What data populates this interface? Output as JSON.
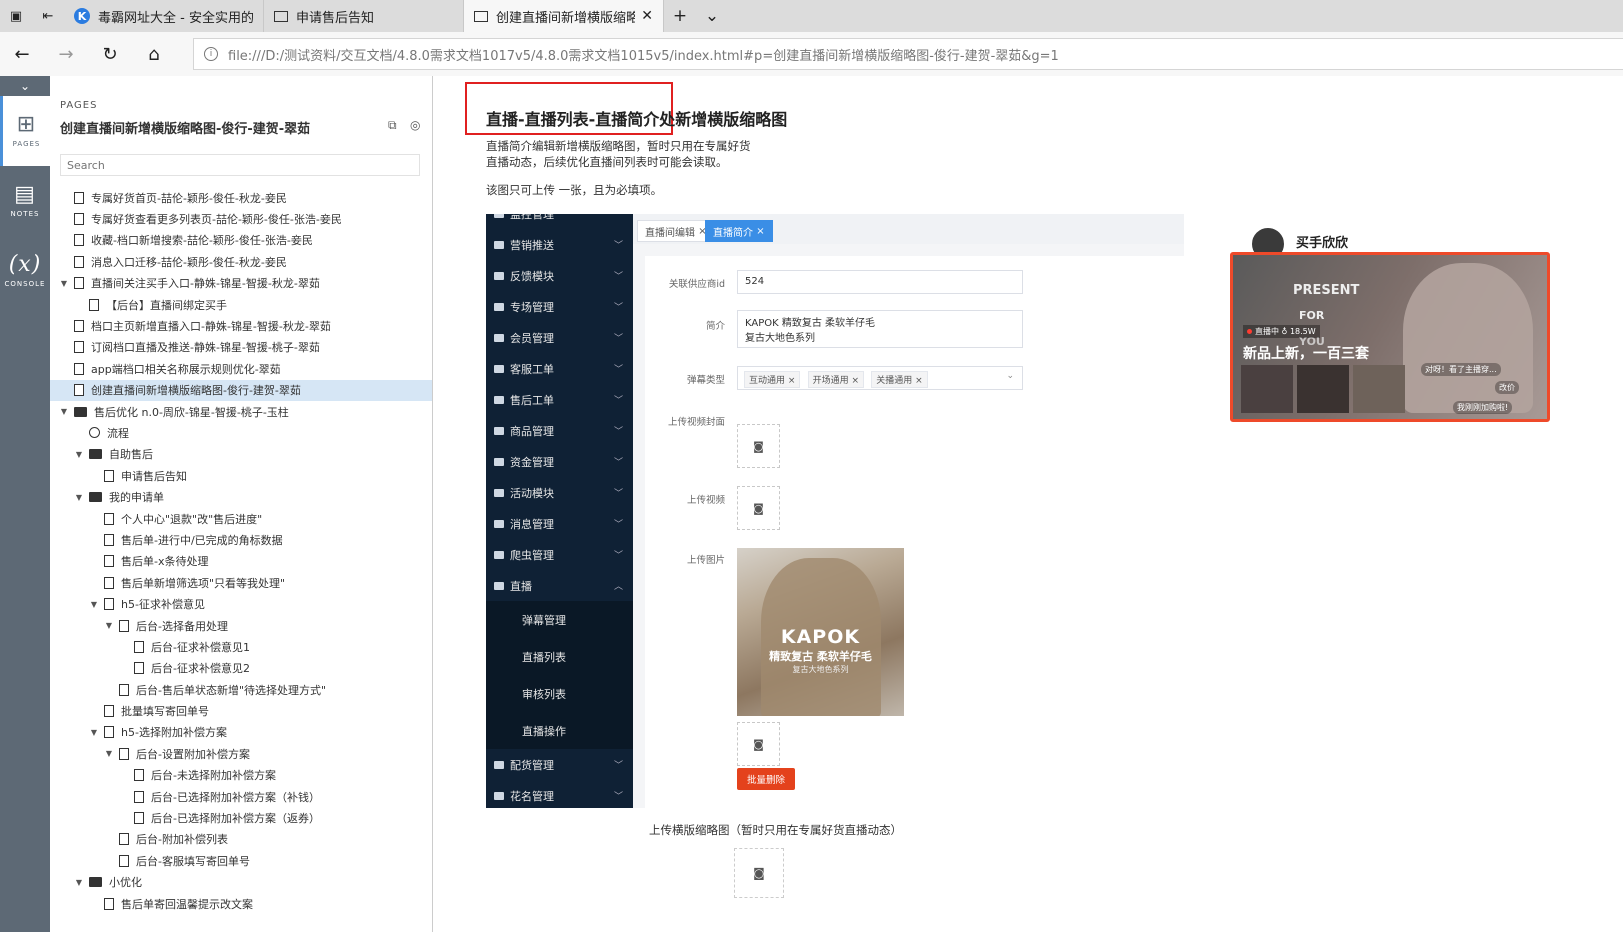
{
  "browser": {
    "tabs": [
      {
        "label": "毒霸网址大全 - 安全实用的"
      },
      {
        "label": "申请售后告知"
      },
      {
        "label": "创建直播间新增横版缩略"
      }
    ],
    "url": "file:///D:/测试资料/交互文档/4.8.0需求文档1017v5/4.8.0需求文档1015v5/index.html#p=创建直播间新增横版缩略图-俊行-建贺-翠茹&g=1"
  },
  "rail": {
    "pages": "PAGES",
    "notes": "NOTES",
    "console": "CONSOLE"
  },
  "sidebar": {
    "section_label": "PAGES",
    "title": "创建直播间新增横版缩略图-俊行-建贺-翠茹",
    "search_placeholder": "Search",
    "tree": [
      {
        "label": "专属好货首页-喆伦-颖彤-俊任-秋龙-妾民",
        "depth": 0,
        "type": "page"
      },
      {
        "label": "专属好货查看更多列表页-喆伦-颖彤-俊任-张浩-妾民",
        "depth": 0,
        "type": "page"
      },
      {
        "label": "收藏-档口新增搜索-喆伦-颖彤-俊任-张浩-妾民",
        "depth": 0,
        "type": "page"
      },
      {
        "label": "消息入口迁移-喆伦-颖彤-俊任-秋龙-妾民",
        "depth": 0,
        "type": "page"
      },
      {
        "label": "直播间关注买手入口-静姝-锦星-智援-秋龙-翠茹",
        "depth": 0,
        "type": "page",
        "expanded": true
      },
      {
        "label": "【后台】直播间绑定买手",
        "depth": 1,
        "type": "page"
      },
      {
        "label": "档口主页新增直播入口-静姝-锦星-智援-秋龙-翠茹",
        "depth": 0,
        "type": "page"
      },
      {
        "label": "订阅档口直播及推送-静姝-锦星-智援-桃子-翠茹",
        "depth": 0,
        "type": "page"
      },
      {
        "label": "app端档口相关名称展示规则优化-翠茹",
        "depth": 0,
        "type": "page"
      },
      {
        "label": "创建直播间新增横版缩略图-俊行-建贺-翠茹",
        "depth": 0,
        "type": "page",
        "selected": true
      },
      {
        "label": "售后优化 n.0-周欣-锦星-智援-桃子-玉柱",
        "depth": 0,
        "type": "folder",
        "expanded": true
      },
      {
        "label": "流程",
        "depth": 1,
        "type": "flow"
      },
      {
        "label": "自助售后",
        "depth": 1,
        "type": "folder",
        "expanded": true
      },
      {
        "label": "申请售后告知",
        "depth": 2,
        "type": "page"
      },
      {
        "label": "我的申请单",
        "depth": 1,
        "type": "folder",
        "expanded": true
      },
      {
        "label": "个人中心\"退款\"改\"售后进度\"",
        "depth": 2,
        "type": "page"
      },
      {
        "label": "售后单-进行中/已完成的角标数据",
        "depth": 2,
        "type": "page"
      },
      {
        "label": "售后单-x条待处理",
        "depth": 2,
        "type": "page"
      },
      {
        "label": "售后单新增筛选项\"只看等我处理\"",
        "depth": 2,
        "type": "page"
      },
      {
        "label": "h5-征求补偿意见",
        "depth": 2,
        "type": "page",
        "expanded": true
      },
      {
        "label": "后台-选择备用处理",
        "depth": 3,
        "type": "page",
        "expanded": true
      },
      {
        "label": "后台-征求补偿意见1",
        "depth": 4,
        "type": "page"
      },
      {
        "label": "后台-征求补偿意见2",
        "depth": 4,
        "type": "page"
      },
      {
        "label": "后台-售后单状态新增\"待选择处理方式\"",
        "depth": 3,
        "type": "page"
      },
      {
        "label": "批量填写寄回单号",
        "depth": 2,
        "type": "page"
      },
      {
        "label": "h5-选择附加补偿方案",
        "depth": 2,
        "type": "page",
        "expanded": true
      },
      {
        "label": "后台-设置附加补偿方案",
        "depth": 3,
        "type": "page",
        "expanded": true
      },
      {
        "label": "后台-未选择附加补偿方案",
        "depth": 4,
        "type": "page"
      },
      {
        "label": "后台-已选择附加补偿方案（补钱）",
        "depth": 4,
        "type": "page"
      },
      {
        "label": "后台-已选择附加补偿方案（返券）",
        "depth": 4,
        "type": "page"
      },
      {
        "label": "后台-附加补偿列表",
        "depth": 3,
        "type": "page"
      },
      {
        "label": "后台-客服填写寄回单号",
        "depth": 3,
        "type": "page"
      },
      {
        "label": "小优化",
        "depth": 1,
        "type": "folder",
        "expanded": true
      },
      {
        "label": "售后单寄回温馨提示改文案",
        "depth": 2,
        "type": "page"
      }
    ]
  },
  "main": {
    "heading": "直播-直播列表-直播简介处新增横版缩略图",
    "note_line1": "直播简介编辑新增横版缩略图，暂时只用在专属好货",
    "note_line2": "直播动态，后续优化直播间列表时可能会读取。",
    "note_line3": "该图只可上传 一张，且为必填项。",
    "admin": {
      "menu": [
        {
          "label": "监控管理"
        },
        {
          "label": "营销推送"
        },
        {
          "label": "反馈模块"
        },
        {
          "label": "专场管理"
        },
        {
          "label": "会员管理"
        },
        {
          "label": "客服工单"
        },
        {
          "label": "售后工单"
        },
        {
          "label": "商品管理"
        },
        {
          "label": "资金管理"
        },
        {
          "label": "活动模块"
        },
        {
          "label": "消息管理"
        },
        {
          "label": "爬虫管理"
        },
        {
          "label": "直播",
          "open": true
        },
        {
          "label": "弹幕管理",
          "sub": true
        },
        {
          "label": "直播列表",
          "sub": true
        },
        {
          "label": "审核列表",
          "sub": true
        },
        {
          "label": "直播操作",
          "sub": true
        },
        {
          "label": "配货管理"
        },
        {
          "label": "花名管理"
        }
      ],
      "tabs": [
        "直播间编辑",
        "直播简介"
      ],
      "form": {
        "supplier_label": "关联供应商id",
        "supplier_value": "524",
        "intro_label": "简介",
        "intro_line1": "KAPOK 精致复古 柔软羊仔毛",
        "intro_line2": "复古大地色系列",
        "danmu_label": "弹幕类型",
        "danmu_tags": [
          "互动通用",
          "开场通用",
          "关播通用"
        ],
        "video_cover_label": "上传视频封面",
        "video_label": "上传视频",
        "image_label": "上传图片",
        "kapok_brand": "KAPOK",
        "kapok_sub1": "精致复古 柔软羊仔毛",
        "kapok_sub2": "复古大地色系列",
        "batch_delete": "批量删除"
      }
    },
    "landscape_label": "上传横版缩略图（暂时只用在专属好货直播动态）",
    "preview": {
      "name": "买手欣欣",
      "present": "PRESENT",
      "for": "FOR",
      "you": "YOU",
      "live_badge": "直播中 ♁ 18.5W",
      "headline": "新品上新，一百三套",
      "bubble": "对呀！看了主播穿...",
      "price": "改价",
      "buy": "我刚刚加购啦!"
    }
  }
}
